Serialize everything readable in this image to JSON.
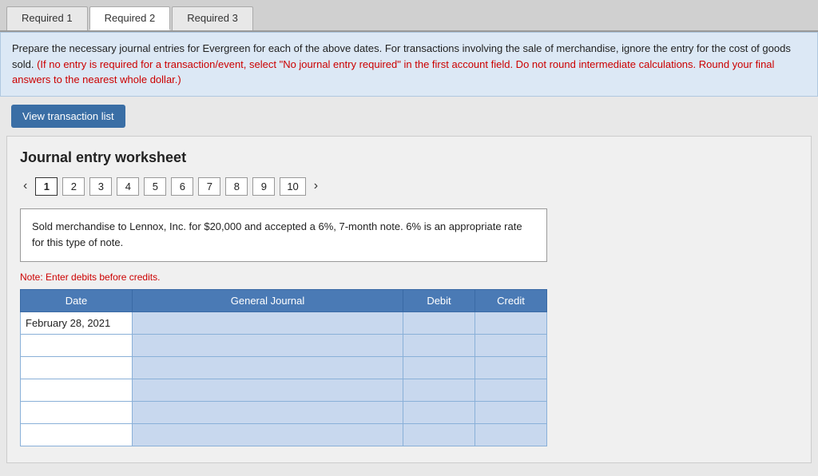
{
  "tabs": [
    {
      "label": "Required 1",
      "active": false
    },
    {
      "label": "Required 2",
      "active": true
    },
    {
      "label": "Required 3",
      "active": false
    }
  ],
  "instruction": {
    "main_text": "Prepare the necessary journal entries for Evergreen for each of the above dates. For transactions involving the sale of merchandise, ignore the entry for the cost of goods sold.",
    "red_text": "(If no entry is required for a transaction/event, select \"No journal entry required\" in the first account field. Do not round intermediate calculations. Round your final answers to the nearest whole dollar.)"
  },
  "view_transaction_button": "View transaction list",
  "worksheet": {
    "title": "Journal entry worksheet",
    "pages": [
      "1",
      "2",
      "3",
      "4",
      "5",
      "6",
      "7",
      "8",
      "9",
      "10"
    ],
    "active_page": "1",
    "description": "Sold merchandise to Lennox, Inc. for $20,000 and accepted a 6%, 7-month note. 6% is an appropriate rate for this type of note.",
    "note": "Note: Enter debits before credits.",
    "table": {
      "headers": [
        "Date",
        "General Journal",
        "Debit",
        "Credit"
      ],
      "rows": [
        {
          "date": "February 28, 2021",
          "journal": "",
          "debit": "",
          "credit": ""
        },
        {
          "date": "",
          "journal": "",
          "debit": "",
          "credit": ""
        },
        {
          "date": "",
          "journal": "",
          "debit": "",
          "credit": ""
        },
        {
          "date": "",
          "journal": "",
          "debit": "",
          "credit": ""
        },
        {
          "date": "",
          "journal": "",
          "debit": "",
          "credit": ""
        },
        {
          "date": "",
          "journal": "",
          "debit": "",
          "credit": ""
        }
      ]
    }
  }
}
